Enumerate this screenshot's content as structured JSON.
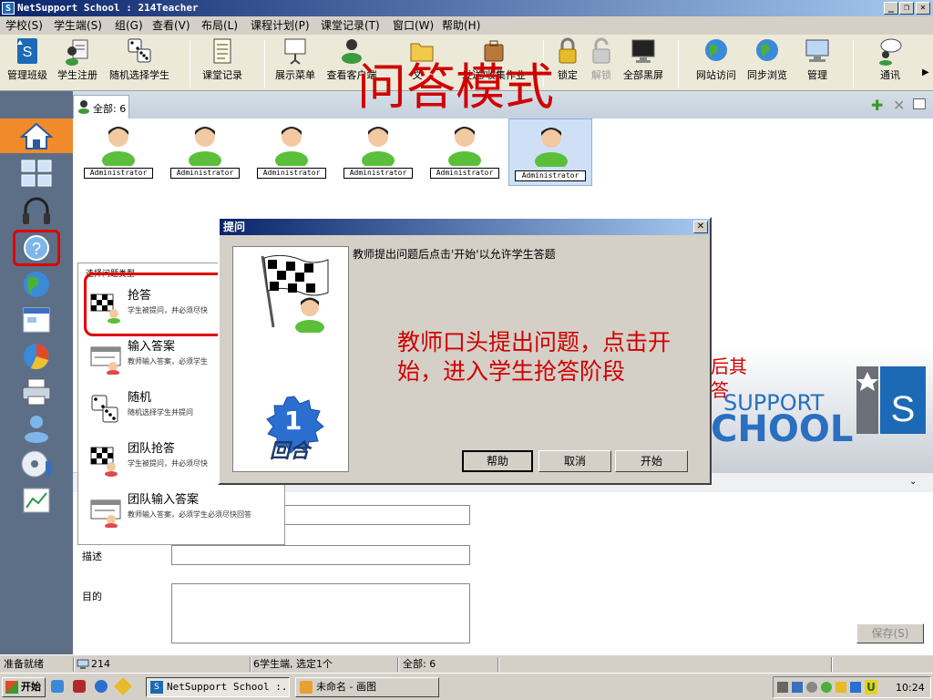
{
  "window": {
    "title": "NetSupport School : 214Teacher",
    "app_icon": "S"
  },
  "menu": [
    "学校(S)",
    "学生端(S)",
    "组(G)",
    "查看(V)",
    "布局(L)",
    "课程计划(P)",
    "课堂记录(T)",
    "窗口(W)",
    "帮助(H)"
  ],
  "toolbar": [
    {
      "label": "管理班级",
      "icon": "manage-class-icon"
    },
    {
      "label": "学生注册",
      "icon": "student-register-icon"
    },
    {
      "label": "随机选择学生",
      "icon": "dice-icon"
    },
    {
      "label": "课堂记录",
      "icon": "class-record-icon"
    },
    {
      "label": "展示菜单",
      "icon": "presentation-icon"
    },
    {
      "label": "查看客户端",
      "icon": "view-client-icon"
    },
    {
      "label": "文",
      "icon": "file-transfer-icon"
    },
    {
      "label": "发送/收集作业",
      "icon": "send-collect-icon"
    },
    {
      "label": "锁定",
      "icon": "lock-icon"
    },
    {
      "label": "解锁",
      "icon": "unlock-icon"
    },
    {
      "label": "全部黑屏",
      "icon": "monitor-icon"
    },
    {
      "label": "网站访问",
      "icon": "web-access-icon"
    },
    {
      "label": "同步浏览",
      "icon": "sync-browse-icon"
    },
    {
      "label": "管理",
      "icon": "manage-icon"
    },
    {
      "label": "通讯",
      "icon": "communication-icon"
    }
  ],
  "annotation_title": "问答模式",
  "tab": {
    "label": "全部: 6"
  },
  "students": [
    "Administrator",
    "Administrator",
    "Administrator",
    "Administrator",
    "Administrator",
    "Administrator"
  ],
  "question_panel": {
    "header": "选择问题类型",
    "items": [
      {
        "title": "抢答",
        "desc": "学生被提问，并必须尽快"
      },
      {
        "title": "输入答案",
        "desc": "教师输入答案，必须学生"
      },
      {
        "title": "随机",
        "desc": "随机选择学生并提问"
      },
      {
        "title": "团队抢答",
        "desc": "学生被提问，并必须尽快"
      },
      {
        "title": "团队输入答案",
        "desc": "教师输入答案，必须学生必须尽快回答"
      }
    ]
  },
  "dialog": {
    "title": "提问",
    "instruction": "教师提出问题后点击'开始'以允许学生答题",
    "round_number": "1",
    "round_label": "回合",
    "buttons": {
      "help": "帮助",
      "cancel": "取消",
      "start": "开始"
    }
  },
  "annotation_dialog": "教师口头提出问题，点击开始，进入学生抢答阶段",
  "background_text": {
    "line1": "后其",
    "line2": "答",
    "brand_upper": "SUPPORT",
    "brand_lower": "CHOOL"
  },
  "form": {
    "desc_label": "描述",
    "purpose_label": "目的",
    "save": "保存(S)"
  },
  "status": {
    "ready": "准备就绪",
    "count": "214",
    "students": "6学生端, 选定1个",
    "all": "全部: 6"
  },
  "taskbar": {
    "start": "开始",
    "task1": "NetSupport School :...",
    "task2": "未命名 - 画图",
    "clock": "10:24"
  }
}
